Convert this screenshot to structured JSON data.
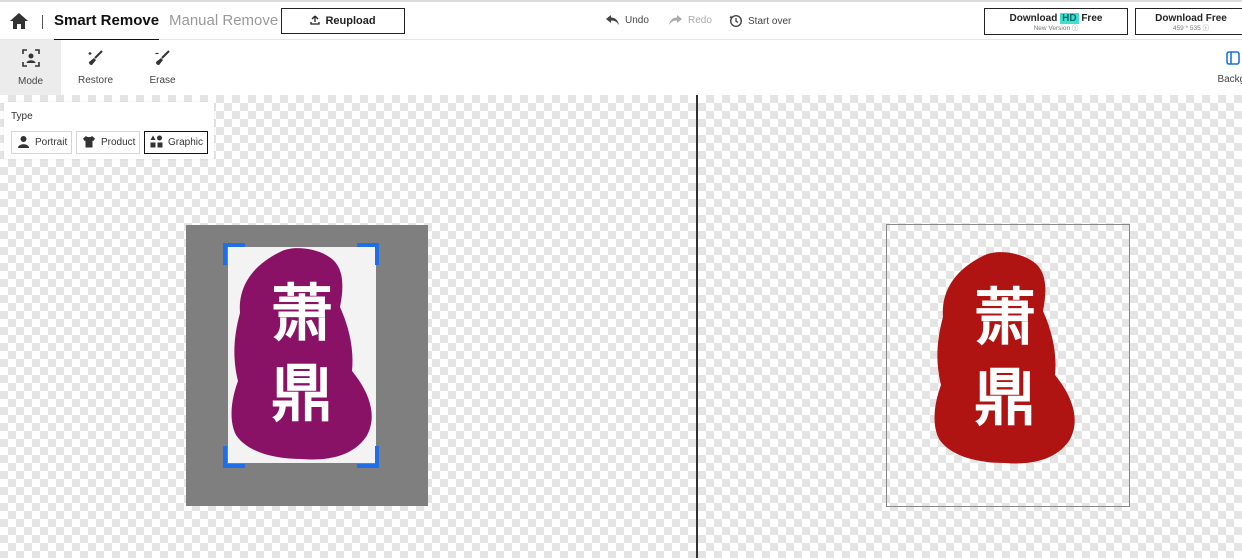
{
  "header": {
    "tabs": [
      {
        "label": "Smart Remove",
        "active": true
      },
      {
        "label": "Manual Remove",
        "active": false
      }
    ],
    "reupload_label": "Reupload",
    "undo_label": "Undo",
    "redo_label": "Redo",
    "start_over_label": "Start over",
    "download_hd": {
      "prefix": "Download",
      "badge": "HD",
      "suffix": "Free",
      "sub": "New Version"
    },
    "download_free": {
      "label": "Download Free",
      "sub": "459 * 535"
    }
  },
  "toolbar": {
    "items": [
      {
        "label": "Mode",
        "active": true,
        "icon": "mode-icon"
      },
      {
        "label": "Restore",
        "active": false,
        "icon": "restore-brush-icon"
      },
      {
        "label": "Erase",
        "active": false,
        "icon": "erase-brush-icon"
      }
    ],
    "background_label": "Backgr"
  },
  "type_panel": {
    "title": "Type",
    "options": [
      {
        "label": "Portrait",
        "selected": false,
        "icon": "person-icon"
      },
      {
        "label": "Product",
        "selected": false,
        "icon": "shirt-icon"
      },
      {
        "label": "Graphic",
        "selected": true,
        "icon": "graphic-icon"
      }
    ]
  },
  "images": {
    "seal_characters": [
      "萧",
      "鼎"
    ],
    "original_seal_color": "#8a1266",
    "result_seal_color": "#b01412"
  },
  "colors": {
    "handle": "#1f6fe8",
    "hd_badge": "#3ee0d3",
    "frame_gray": "#7f7f7f"
  }
}
